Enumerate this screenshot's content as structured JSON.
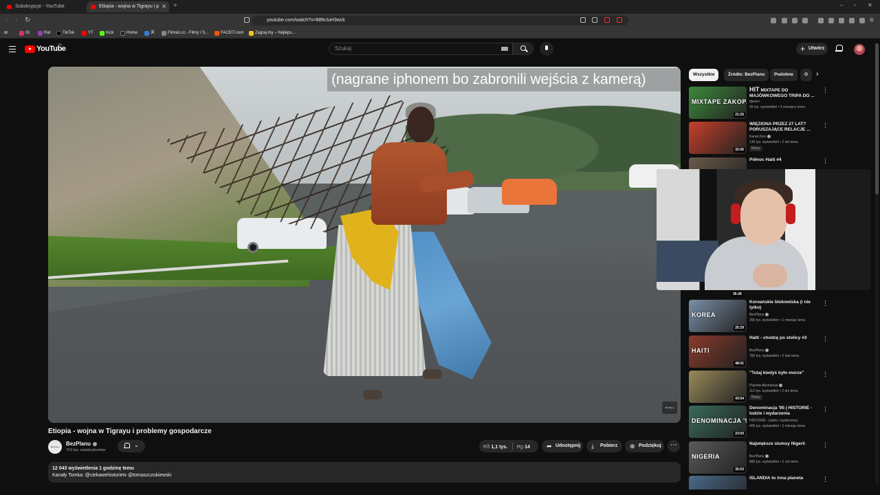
{
  "browser": {
    "tabs": [
      {
        "title": "Subskrypcje - YouTube",
        "active": false
      },
      {
        "title": "Etiopia - wojna w Tigrayu i p",
        "active": true
      }
    ],
    "url": "youtube.com/watch?v=88feJuH3wck",
    "bookmarks": [
      "IG",
      "Rat",
      "TikTok",
      "YT",
      "Kick",
      "Home",
      "天",
      "Filman.cc - Filmy i S...",
      "FACEIT.com",
      "Zagraj.my – Najleps..."
    ]
  },
  "header": {
    "logo_text": "YouTube",
    "country_code": "PL",
    "search_placeholder": "Szukaj",
    "create_label": "Utwórz"
  },
  "video": {
    "caption": "(nagrane iphonem bo zabronili wejścia z kamerą)",
    "watermark": "BezPlanu",
    "title": "Etiopia - wojna w Tigrayu i problemy gospodarcze",
    "channel": "BezPlanu",
    "channel_avatar_text": "BezPlanu",
    "subscribers": "719 tys. subskrybentów",
    "likes": "1,1 tys.",
    "dislikes": "14",
    "share_label": "Udostępnij",
    "download_label": "Pobierz",
    "thanks_label": "Podziękuj",
    "views_line": "12 043 wyświetlenia  1 godzinę temu",
    "description_line": "Kanały Tomka:  @ciekawehistorietv  @tomaszczukiewski"
  },
  "chips": [
    "Wszystkie",
    "Źródło: BezPlanu",
    "Podobne",
    "O"
  ],
  "recommendations": [
    {
      "title": "MIXTAPE DO MAJÓWKOWEGO TRIPA DO ...",
      "channel": "djsuen",
      "meta": "25 tys. wyświetleń • 6 miesięcy temu",
      "duration": "21:25",
      "badge": "",
      "verified": false,
      "thumb_color": "#3d8a3a",
      "thumb_text": "MIXTAPE ZAKOPANE",
      "title_prefix": "HIT"
    },
    {
      "title": "WIĘZIONA PRZEZ 27 LAT? PORUSZAJĄCE RELACJE ...",
      "channel": "Kanał Zero",
      "meta": "136 tys. wyświetleń • 2 dni temu",
      "duration": "32:06",
      "badge": "Nowy",
      "verified": true,
      "thumb_color": "#c8402a",
      "thumb_text": "",
      "title_prefix": ""
    },
    {
      "title": "Północ Haiti #4",
      "channel": "",
      "meta": "",
      "duration": "",
      "badge": "",
      "verified": false,
      "thumb_color": "#6a5a4a",
      "thumb_text": "",
      "title_prefix": ""
    },
    {
      "title": "Koreańskie blokowiska (i nie tylko)",
      "channel": "BezPlanu",
      "meta": "266 tys. wyświetleń • 1 miesiąc temu",
      "duration": "25:29",
      "badge": "",
      "verified": true,
      "thumb_color": "#7a8fa8",
      "thumb_text": "KOREA",
      "title_prefix": ""
    },
    {
      "title": "Haiti - chodzę po stolicy #3",
      "channel": "BezPlanu",
      "meta": "782 tys. wyświetleń • 2 lata temu",
      "duration": "48:01",
      "badge": "",
      "verified": true,
      "thumb_color": "#8a3a2a",
      "thumb_text": "HAITI",
      "title_prefix": ""
    },
    {
      "title": "\"Tutaj kiedyś było morze\"",
      "channel": "Planeta Abstrakcja",
      "meta": "112 tys. wyświetleń • 2 dni temu",
      "duration": "43:54",
      "badge": "Nowy",
      "verified": true,
      "thumb_color": "#9a8a5a",
      "thumb_text": "",
      "title_prefix": ""
    },
    {
      "title": "Denominacja '95 | HISTORIE - ludzie i wydarzenia",
      "channel": "HISTORIE - ludzie i wydarzenia",
      "meta": "400 tys. wyświetleń • 1 miesiąc temu",
      "duration": "23:50",
      "badge": "",
      "verified": false,
      "thumb_color": "#3a6a5a",
      "thumb_text": "DENOMINACJA '95",
      "title_prefix": ""
    },
    {
      "title": "Największe slumsy Nigerii",
      "channel": "BezPlanu",
      "meta": "880 tys. wyświetleń • 1 rok temu",
      "duration": "35:03",
      "badge": "",
      "verified": true,
      "thumb_color": "#5a5a5a",
      "thumb_text": "NIGERIA",
      "title_prefix": ""
    },
    {
      "title": "ISLANDIA to inna planeta",
      "channel": "",
      "meta": "",
      "duration": "",
      "badge": "",
      "verified": false,
      "thumb_color": "#4a6a8a",
      "thumb_text": "",
      "title_prefix": ""
    }
  ],
  "webcam_overlay_duration": "36:28"
}
